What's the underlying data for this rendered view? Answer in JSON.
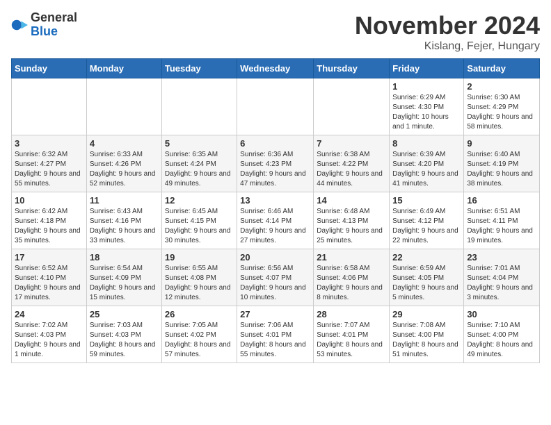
{
  "logo": {
    "general": "General",
    "blue": "Blue"
  },
  "header": {
    "month": "November 2024",
    "location": "Kislang, Fejer, Hungary"
  },
  "weekdays": [
    "Sunday",
    "Monday",
    "Tuesday",
    "Wednesday",
    "Thursday",
    "Friday",
    "Saturday"
  ],
  "weeks": [
    [
      {
        "day": "",
        "info": ""
      },
      {
        "day": "",
        "info": ""
      },
      {
        "day": "",
        "info": ""
      },
      {
        "day": "",
        "info": ""
      },
      {
        "day": "",
        "info": ""
      },
      {
        "day": "1",
        "info": "Sunrise: 6:29 AM\nSunset: 4:30 PM\nDaylight: 10 hours and 1 minute."
      },
      {
        "day": "2",
        "info": "Sunrise: 6:30 AM\nSunset: 4:29 PM\nDaylight: 9 hours and 58 minutes."
      }
    ],
    [
      {
        "day": "3",
        "info": "Sunrise: 6:32 AM\nSunset: 4:27 PM\nDaylight: 9 hours and 55 minutes."
      },
      {
        "day": "4",
        "info": "Sunrise: 6:33 AM\nSunset: 4:26 PM\nDaylight: 9 hours and 52 minutes."
      },
      {
        "day": "5",
        "info": "Sunrise: 6:35 AM\nSunset: 4:24 PM\nDaylight: 9 hours and 49 minutes."
      },
      {
        "day": "6",
        "info": "Sunrise: 6:36 AM\nSunset: 4:23 PM\nDaylight: 9 hours and 47 minutes."
      },
      {
        "day": "7",
        "info": "Sunrise: 6:38 AM\nSunset: 4:22 PM\nDaylight: 9 hours and 44 minutes."
      },
      {
        "day": "8",
        "info": "Sunrise: 6:39 AM\nSunset: 4:20 PM\nDaylight: 9 hours and 41 minutes."
      },
      {
        "day": "9",
        "info": "Sunrise: 6:40 AM\nSunset: 4:19 PM\nDaylight: 9 hours and 38 minutes."
      }
    ],
    [
      {
        "day": "10",
        "info": "Sunrise: 6:42 AM\nSunset: 4:18 PM\nDaylight: 9 hours and 35 minutes."
      },
      {
        "day": "11",
        "info": "Sunrise: 6:43 AM\nSunset: 4:16 PM\nDaylight: 9 hours and 33 minutes."
      },
      {
        "day": "12",
        "info": "Sunrise: 6:45 AM\nSunset: 4:15 PM\nDaylight: 9 hours and 30 minutes."
      },
      {
        "day": "13",
        "info": "Sunrise: 6:46 AM\nSunset: 4:14 PM\nDaylight: 9 hours and 27 minutes."
      },
      {
        "day": "14",
        "info": "Sunrise: 6:48 AM\nSunset: 4:13 PM\nDaylight: 9 hours and 25 minutes."
      },
      {
        "day": "15",
        "info": "Sunrise: 6:49 AM\nSunset: 4:12 PM\nDaylight: 9 hours and 22 minutes."
      },
      {
        "day": "16",
        "info": "Sunrise: 6:51 AM\nSunset: 4:11 PM\nDaylight: 9 hours and 19 minutes."
      }
    ],
    [
      {
        "day": "17",
        "info": "Sunrise: 6:52 AM\nSunset: 4:10 PM\nDaylight: 9 hours and 17 minutes."
      },
      {
        "day": "18",
        "info": "Sunrise: 6:54 AM\nSunset: 4:09 PM\nDaylight: 9 hours and 15 minutes."
      },
      {
        "day": "19",
        "info": "Sunrise: 6:55 AM\nSunset: 4:08 PM\nDaylight: 9 hours and 12 minutes."
      },
      {
        "day": "20",
        "info": "Sunrise: 6:56 AM\nSunset: 4:07 PM\nDaylight: 9 hours and 10 minutes."
      },
      {
        "day": "21",
        "info": "Sunrise: 6:58 AM\nSunset: 4:06 PM\nDaylight: 9 hours and 8 minutes."
      },
      {
        "day": "22",
        "info": "Sunrise: 6:59 AM\nSunset: 4:05 PM\nDaylight: 9 hours and 5 minutes."
      },
      {
        "day": "23",
        "info": "Sunrise: 7:01 AM\nSunset: 4:04 PM\nDaylight: 9 hours and 3 minutes."
      }
    ],
    [
      {
        "day": "24",
        "info": "Sunrise: 7:02 AM\nSunset: 4:03 PM\nDaylight: 9 hours and 1 minute."
      },
      {
        "day": "25",
        "info": "Sunrise: 7:03 AM\nSunset: 4:03 PM\nDaylight: 8 hours and 59 minutes."
      },
      {
        "day": "26",
        "info": "Sunrise: 7:05 AM\nSunset: 4:02 PM\nDaylight: 8 hours and 57 minutes."
      },
      {
        "day": "27",
        "info": "Sunrise: 7:06 AM\nSunset: 4:01 PM\nDaylight: 8 hours and 55 minutes."
      },
      {
        "day": "28",
        "info": "Sunrise: 7:07 AM\nSunset: 4:01 PM\nDaylight: 8 hours and 53 minutes."
      },
      {
        "day": "29",
        "info": "Sunrise: 7:08 AM\nSunset: 4:00 PM\nDaylight: 8 hours and 51 minutes."
      },
      {
        "day": "30",
        "info": "Sunrise: 7:10 AM\nSunset: 4:00 PM\nDaylight: 8 hours and 49 minutes."
      }
    ]
  ]
}
